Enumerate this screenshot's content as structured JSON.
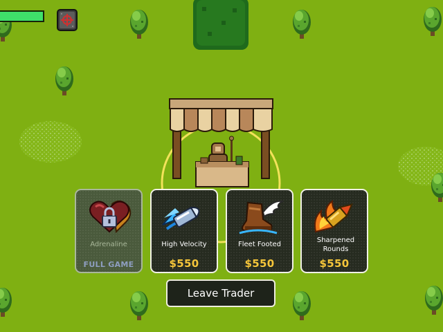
{
  "hud": {
    "health_fraction": 1.0,
    "health_color": "#3fe06a",
    "map_icon": "map-target-icon"
  },
  "trader": {
    "cards": [
      {
        "name": "Adrenaline",
        "status": "FULL GAME",
        "locked": true,
        "icon": "heart-lock-icon"
      },
      {
        "name": "High Velocity",
        "price": "$550",
        "locked": false,
        "icon": "blue-bullet-icon"
      },
      {
        "name": "Fleet Footed",
        "price": "$550",
        "locked": false,
        "icon": "winged-boot-icon"
      },
      {
        "name": "Sharpened Rounds",
        "price": "$550",
        "locked": false,
        "icon": "flaming-bullet-icon"
      }
    ],
    "leave_label": "Leave Trader"
  },
  "colors": {
    "grass": "#7fb012",
    "price": "#f6c63a",
    "locked_label": "#8e9ec0"
  }
}
